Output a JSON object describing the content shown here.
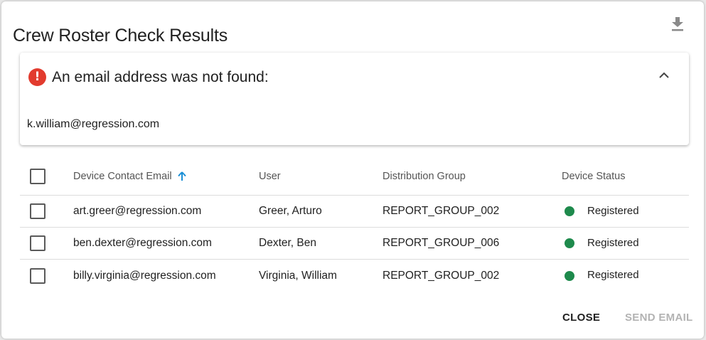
{
  "dialog": {
    "title": "Crew Roster Check Results",
    "download_icon": "download-icon"
  },
  "alert": {
    "icon": "error-icon",
    "icon_glyph": "!",
    "title": "An email address was not found:",
    "collapse_icon": "chevron-up-icon",
    "missing_email": "k.william@regression.com"
  },
  "table": {
    "headers": {
      "email": "Device Contact Email",
      "user": "User",
      "group": "Distribution Group",
      "status": "Device Status"
    },
    "sort_icon": "arrow-up-icon",
    "rows": [
      {
        "email": "art.greer@regression.com",
        "user": "Greer, Arturo",
        "group": "REPORT_GROUP_002",
        "status": "Registered"
      },
      {
        "email": "ben.dexter@regression.com",
        "user": "Dexter, Ben",
        "group": "REPORT_GROUP_006",
        "status": "Registered"
      },
      {
        "email": "billy.virginia@regression.com",
        "user": "Virginia, William",
        "group": "REPORT_GROUP_002",
        "status": "Registered"
      }
    ]
  },
  "actions": {
    "close_label": "CLOSE",
    "send_label": "SEND EMAIL"
  },
  "colors": {
    "error": "#e23b2e",
    "registered": "#1e8a4c",
    "sort_accent": "#1a8fd6",
    "disabled_text": "#b3b3b3"
  }
}
